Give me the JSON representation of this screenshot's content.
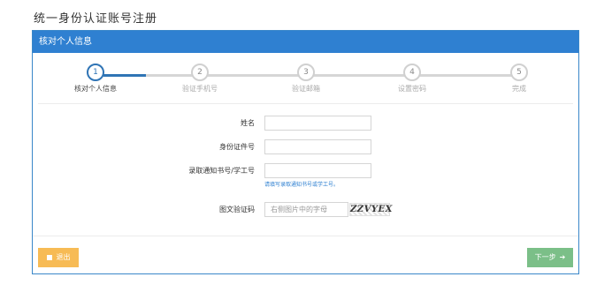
{
  "page": {
    "title": "统一身份认证账号注册"
  },
  "panel": {
    "header": "核对个人信息"
  },
  "steps": [
    {
      "number": "1",
      "label": "核对个人信息",
      "active": true
    },
    {
      "number": "2",
      "label": "验证手机号",
      "active": false
    },
    {
      "number": "3",
      "label": "验证邮箱",
      "active": false
    },
    {
      "number": "4",
      "label": "设置密码",
      "active": false
    },
    {
      "number": "5",
      "label": "完成",
      "active": false
    }
  ],
  "form": {
    "name": {
      "label": "姓名",
      "value": "",
      "placeholder": ""
    },
    "id_number": {
      "label": "身份证件号",
      "value": "",
      "placeholder": ""
    },
    "admission": {
      "label": "录取通知书号/学工号",
      "value": "",
      "placeholder": "",
      "hint": "请填写录取通知书号或学工号。"
    },
    "captcha": {
      "label": "图文验证码",
      "value": "",
      "placeholder": "右侧图片中的字母",
      "image_text": "ZZVYEX"
    }
  },
  "buttons": {
    "exit": "退出",
    "next": "下一步"
  },
  "colors": {
    "primary": "#2f80d1",
    "exit": "#f7bb55",
    "next": "#7bbf88"
  }
}
